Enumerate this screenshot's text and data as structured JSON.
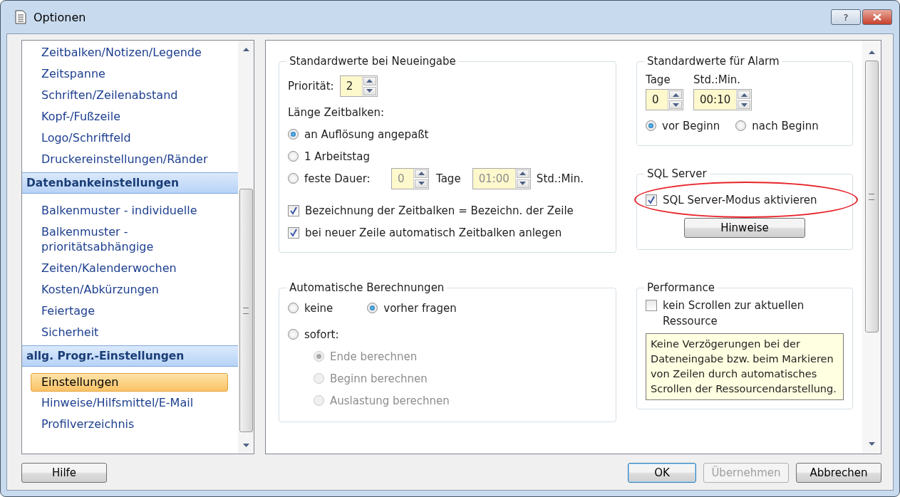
{
  "window": {
    "title": "Optionen",
    "help_glyph": "?"
  },
  "sidebar": {
    "items": [
      {
        "kind": "item",
        "label": "Zeitbalken/Notizen/Legende",
        "selected": false
      },
      {
        "kind": "item",
        "label": "Zeitspanne",
        "selected": false
      },
      {
        "kind": "item",
        "label": "Schriften/Zeilenabstand",
        "selected": false
      },
      {
        "kind": "item",
        "label": "Kopf-/Fußzeile",
        "selected": false
      },
      {
        "kind": "item",
        "label": "Logo/Schriftfeld",
        "selected": false
      },
      {
        "kind": "item",
        "label": "Druckereinstellungen/Ränder",
        "selected": false
      },
      {
        "kind": "header",
        "label": "Datenbankeinstellungen"
      },
      {
        "kind": "item",
        "label": "Balkenmuster - individuelle",
        "selected": false
      },
      {
        "kind": "item",
        "label": "Balkenmuster - prioritätsabhängige",
        "selected": false
      },
      {
        "kind": "item",
        "label": "Zeiten/Kalenderwochen",
        "selected": false
      },
      {
        "kind": "item",
        "label": "Kosten/Abkürzungen",
        "selected": false
      },
      {
        "kind": "item",
        "label": "Feiertage",
        "selected": false
      },
      {
        "kind": "item",
        "label": "Sicherheit",
        "selected": false
      },
      {
        "kind": "header",
        "label": "allg. Progr.-Einstellungen"
      },
      {
        "kind": "item",
        "label": "Einstellungen",
        "selected": true
      },
      {
        "kind": "item",
        "label": "Hinweise/Hilfsmittel/E-Mail",
        "selected": false
      },
      {
        "kind": "item",
        "label": "Profilverzeichnis",
        "selected": false
      }
    ]
  },
  "defaults_new_entry": {
    "title": "Standardwerte bei Neueingabe",
    "priority": {
      "label": "Priorität:",
      "value": "2"
    },
    "length_label": "Länge Zeitbalken:",
    "length_options": [
      {
        "label": "an Auflösung angepaßt",
        "selected": true
      },
      {
        "label": "1 Arbeitstag",
        "selected": false
      },
      {
        "label": "feste Dauer:",
        "selected": false
      }
    ],
    "fixed_days": {
      "value": "0",
      "unit": "Tage",
      "disabled": true
    },
    "fixed_time": {
      "value": "01:00",
      "unit": "Std.:Min.",
      "disabled": true
    },
    "checkboxes": [
      {
        "label": "Bezeichnung der Zeitbalken = Bezeichn. der Zeile",
        "checked": true
      },
      {
        "label": "bei neuer Zeile automatisch Zeitbalken anlegen",
        "checked": true
      }
    ]
  },
  "auto_calc": {
    "title": "Automatische Berechnungen",
    "options": [
      {
        "label": "keine",
        "selected": false
      },
      {
        "label": "vorher fragen",
        "selected": true
      },
      {
        "label": "sofort:",
        "selected": false
      }
    ],
    "sub_options": [
      {
        "label": "Ende berechnen",
        "selected": true,
        "disabled": true
      },
      {
        "label": "Beginn berechnen",
        "selected": false,
        "disabled": true
      },
      {
        "label": "Auslastung berechnen",
        "selected": false,
        "disabled": true
      }
    ]
  },
  "alarm": {
    "title": "Standardwerte für Alarm",
    "days": {
      "label": "Tage",
      "value": "0"
    },
    "time": {
      "label": "Std.:Min.",
      "value": "00:10"
    },
    "options": [
      {
        "label": "vor Beginn",
        "selected": true
      },
      {
        "label": "nach Beginn",
        "selected": false
      }
    ]
  },
  "sql": {
    "title": "SQL Server",
    "checkbox": {
      "label": "SQL Server-Modus aktivieren",
      "checked": true,
      "highlighted": true
    },
    "button": "Hinweise"
  },
  "performance": {
    "title": "Performance",
    "checkbox": {
      "label": "kein Scrollen zur aktuellen Ressource",
      "checked": false
    },
    "note": "Keine Verzögerungen bei der Dateneingabe bzw. beim Markieren von Zeilen durch automatisches Scrollen der Ressourcendarstellung."
  },
  "help_button": {
    "label": "Hilfe"
  },
  "buttons": [
    {
      "label": "OK",
      "disabled": false,
      "default": true
    },
    {
      "label": "Übernehmen",
      "disabled": true,
      "default": false
    },
    {
      "label": "Abbrechen",
      "disabled": false,
      "default": false
    }
  ]
}
